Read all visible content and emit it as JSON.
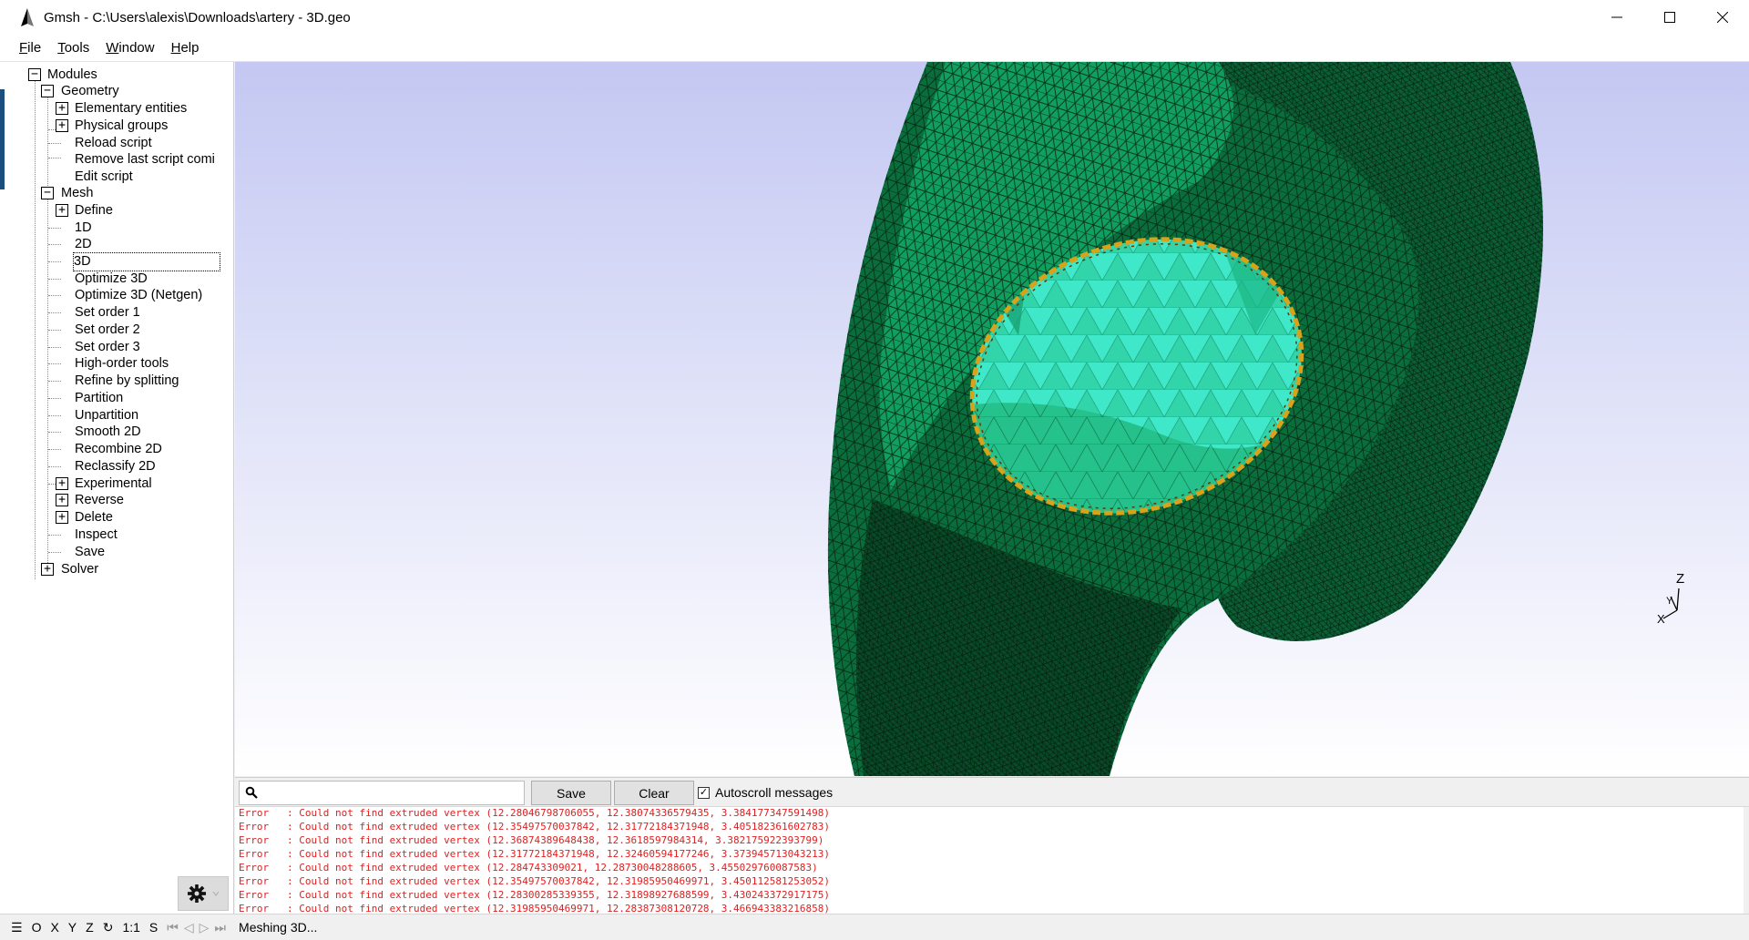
{
  "window": {
    "title": "Gmsh - C:\\Users\\alexis\\Downloads\\artery - 3D.geo"
  },
  "menu": [
    {
      "label": "File",
      "key": "F",
      "rest": "ile"
    },
    {
      "label": "Tools",
      "key": "T",
      "rest": "ools"
    },
    {
      "label": "Window",
      "key": "W",
      "rest": "indow"
    },
    {
      "label": "Help",
      "key": "H",
      "rest": "elp"
    }
  ],
  "tree": {
    "modules": "Modules",
    "geometry": "Geometry",
    "elementary_entities": "Elementary entities",
    "physical_groups": "Physical groups",
    "reload_script": "Reload script",
    "remove_last": "Remove last script comi",
    "edit_script": "Edit script",
    "mesh": "Mesh",
    "define": "Define",
    "m1d": "1D",
    "m2d": "2D",
    "m3d": "3D",
    "optimize_3d": "Optimize 3D",
    "optimize_3d_netgen": "Optimize 3D (Netgen)",
    "set_order_1": "Set order 1",
    "set_order_2": "Set order 2",
    "set_order_3": "Set order 3",
    "high_order_tools": "High-order tools",
    "refine_by_splitting": "Refine by splitting",
    "partition": "Partition",
    "unpartition": "Unpartition",
    "smooth_2d": "Smooth 2D",
    "recombine_2d": "Recombine 2D",
    "reclassify_2d": "Reclassify 2D",
    "experimental": "Experimental",
    "reverse": "Reverse",
    "delete": "Delete",
    "inspect": "Inspect",
    "save": "Save",
    "solver": "Solver"
  },
  "messages": {
    "search_placeholder": "",
    "save_label": "Save",
    "clear_label": "Clear",
    "autoscroll_label": "Autoscroll messages",
    "autoscroll_checked": true,
    "lines": [
      "Error   : Could not find extruded vertex (12.28046798706055, 12.38074336579435, 3.384177347591498)",
      "Error   : Could not find extruded vertex (12.35497570037842, 12.31772184371948, 3.405182361602783)",
      "Error   : Could not find extruded vertex (12.36874389648438, 12.3618597984314, 3.382175922393799)",
      "Error   : Could not find extruded vertex (12.31772184371948, 12.32460594177246, 3.373945713043213)",
      "Error   : Could not find extruded vertex (12.284743309021, 12.28730048288605, 3.455029760087583)",
      "Error   : Could not find extruded vertex (12.35497570037842, 12.31985950469971, 3.450112581253052)",
      "Error   : Could not find extruded vertex (12.28300285339355, 12.31898927688599, 3.430243372917175)",
      "Error   : Could not find extruded vertex (12.31985950469971, 12.28387308120728, 3.466943383216858)"
    ]
  },
  "axes": {
    "z": "Z",
    "y": "Y",
    "x": "X"
  },
  "status": {
    "menu_glyph": "☰",
    "o": "O",
    "x": "X",
    "y": "Y",
    "z": "Z",
    "rotate_glyph": "↻",
    "one_to_one": "1:1",
    "s": "S",
    "first": "⏮",
    "prev": "◁",
    "play": "▷",
    "last": "⏭",
    "text": "Meshing 3D..."
  },
  "colors": {
    "mesh_outer": "#0a6e3c",
    "mesh_face": "#12a866",
    "mesh_inner": "#3fe8c8",
    "mesh_edge_gold": "#d8a21a",
    "background_top": "#c4c8f2",
    "background_bottom": "#ffffff",
    "error_text": "#e02020"
  }
}
